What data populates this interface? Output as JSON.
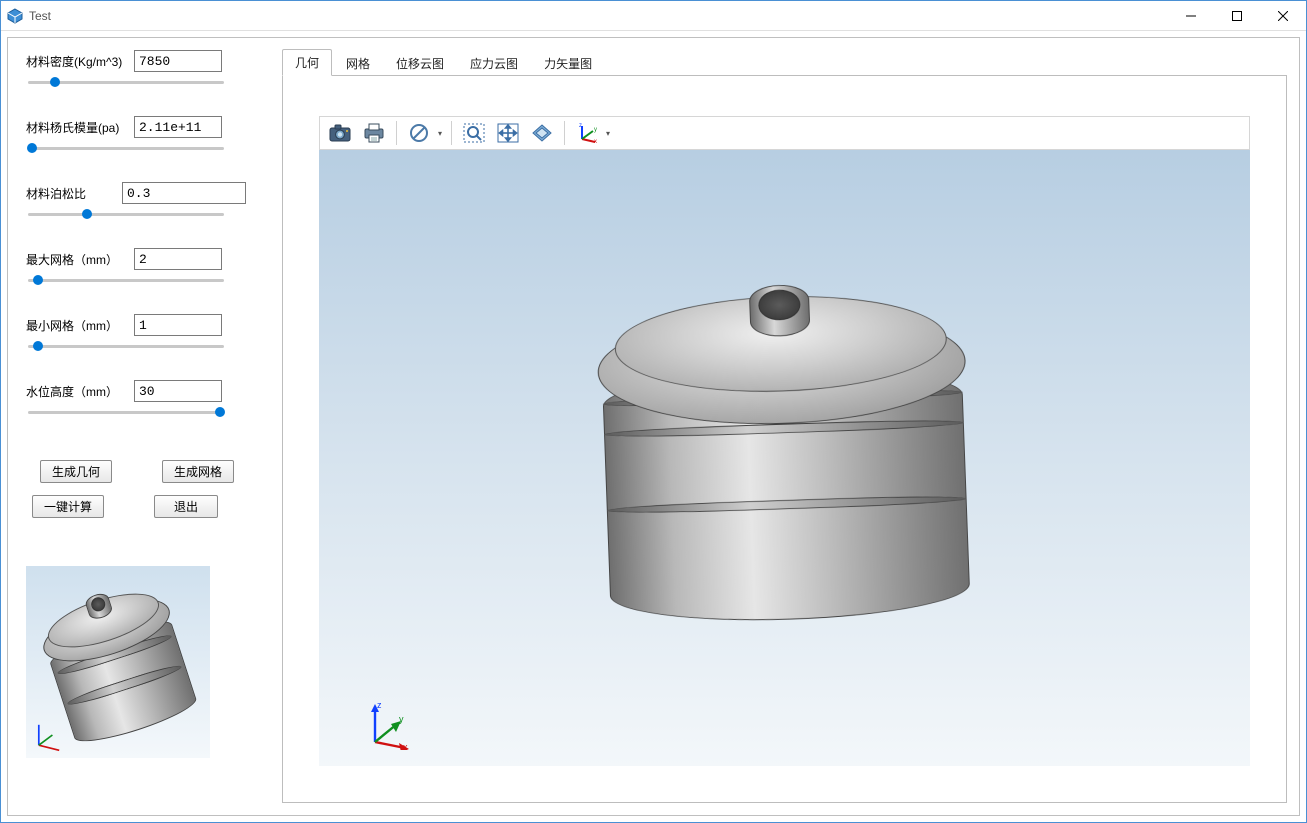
{
  "window": {
    "title": "Test"
  },
  "sidebar": {
    "params": [
      {
        "label": "材料密度(Kg/m^3)",
        "value": "7850",
        "slider_pct": 14
      },
      {
        "label": "材料杨氏模量(pa)",
        "value": "2.11e+11",
        "slider_pct": 2
      },
      {
        "label": "材料泊松比",
        "value": "0.3",
        "slider_pct": 30
      },
      {
        "label": "最大网格（mm）",
        "value": "2",
        "slider_pct": 5
      },
      {
        "label": "最小网格（mm）",
        "value": "1",
        "slider_pct": 5
      },
      {
        "label": "水位高度（mm）",
        "value": "30",
        "slider_pct": 98
      }
    ],
    "buttons": {
      "gen_geometry": "生成几何",
      "gen_mesh": "生成网格",
      "compute": "一键计算",
      "exit": "退出"
    }
  },
  "tabs": [
    {
      "label": "几何",
      "active": true
    },
    {
      "label": "网格",
      "active": false
    },
    {
      "label": "位移云图",
      "active": false
    },
    {
      "label": "应力云图",
      "active": false
    },
    {
      "label": "力矢量图",
      "active": false
    }
  ],
  "toolbar": {
    "items": [
      {
        "name": "camera-icon",
        "title": "截图"
      },
      {
        "name": "print-icon",
        "title": "打印"
      },
      {
        "sep": true
      },
      {
        "name": "prohibit-icon",
        "title": "禁用",
        "dropdown": true
      },
      {
        "sep": true
      },
      {
        "name": "zoom-box-icon",
        "title": "框选缩放"
      },
      {
        "name": "pan-icon",
        "title": "平移"
      },
      {
        "name": "rotate-icon",
        "title": "旋转"
      },
      {
        "sep": true
      },
      {
        "name": "axes-icon",
        "title": "坐标系",
        "dropdown": true
      }
    ]
  },
  "axes": {
    "x": "x",
    "y": "y",
    "z": "z"
  }
}
